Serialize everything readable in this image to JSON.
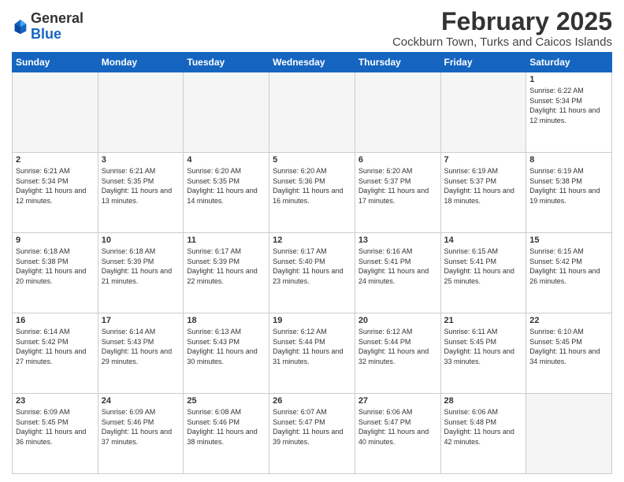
{
  "header": {
    "logo_general": "General",
    "logo_blue": "Blue",
    "month_title": "February 2025",
    "subtitle": "Cockburn Town, Turks and Caicos Islands"
  },
  "weekdays": [
    "Sunday",
    "Monday",
    "Tuesday",
    "Wednesday",
    "Thursday",
    "Friday",
    "Saturday"
  ],
  "weeks": [
    [
      {
        "day": "",
        "info": ""
      },
      {
        "day": "",
        "info": ""
      },
      {
        "day": "",
        "info": ""
      },
      {
        "day": "",
        "info": ""
      },
      {
        "day": "",
        "info": ""
      },
      {
        "day": "",
        "info": ""
      },
      {
        "day": "1",
        "info": "Sunrise: 6:22 AM\nSunset: 5:34 PM\nDaylight: 11 hours and 12 minutes."
      }
    ],
    [
      {
        "day": "2",
        "info": "Sunrise: 6:21 AM\nSunset: 5:34 PM\nDaylight: 11 hours and 12 minutes."
      },
      {
        "day": "3",
        "info": "Sunrise: 6:21 AM\nSunset: 5:35 PM\nDaylight: 11 hours and 13 minutes."
      },
      {
        "day": "4",
        "info": "Sunrise: 6:20 AM\nSunset: 5:35 PM\nDaylight: 11 hours and 14 minutes."
      },
      {
        "day": "5",
        "info": "Sunrise: 6:20 AM\nSunset: 5:36 PM\nDaylight: 11 hours and 16 minutes."
      },
      {
        "day": "6",
        "info": "Sunrise: 6:20 AM\nSunset: 5:37 PM\nDaylight: 11 hours and 17 minutes."
      },
      {
        "day": "7",
        "info": "Sunrise: 6:19 AM\nSunset: 5:37 PM\nDaylight: 11 hours and 18 minutes."
      },
      {
        "day": "8",
        "info": "Sunrise: 6:19 AM\nSunset: 5:38 PM\nDaylight: 11 hours and 19 minutes."
      }
    ],
    [
      {
        "day": "9",
        "info": "Sunrise: 6:18 AM\nSunset: 5:38 PM\nDaylight: 11 hours and 20 minutes."
      },
      {
        "day": "10",
        "info": "Sunrise: 6:18 AM\nSunset: 5:39 PM\nDaylight: 11 hours and 21 minutes."
      },
      {
        "day": "11",
        "info": "Sunrise: 6:17 AM\nSunset: 5:39 PM\nDaylight: 11 hours and 22 minutes."
      },
      {
        "day": "12",
        "info": "Sunrise: 6:17 AM\nSunset: 5:40 PM\nDaylight: 11 hours and 23 minutes."
      },
      {
        "day": "13",
        "info": "Sunrise: 6:16 AM\nSunset: 5:41 PM\nDaylight: 11 hours and 24 minutes."
      },
      {
        "day": "14",
        "info": "Sunrise: 6:15 AM\nSunset: 5:41 PM\nDaylight: 11 hours and 25 minutes."
      },
      {
        "day": "15",
        "info": "Sunrise: 6:15 AM\nSunset: 5:42 PM\nDaylight: 11 hours and 26 minutes."
      }
    ],
    [
      {
        "day": "16",
        "info": "Sunrise: 6:14 AM\nSunset: 5:42 PM\nDaylight: 11 hours and 27 minutes."
      },
      {
        "day": "17",
        "info": "Sunrise: 6:14 AM\nSunset: 5:43 PM\nDaylight: 11 hours and 29 minutes."
      },
      {
        "day": "18",
        "info": "Sunrise: 6:13 AM\nSunset: 5:43 PM\nDaylight: 11 hours and 30 minutes."
      },
      {
        "day": "19",
        "info": "Sunrise: 6:12 AM\nSunset: 5:44 PM\nDaylight: 11 hours and 31 minutes."
      },
      {
        "day": "20",
        "info": "Sunrise: 6:12 AM\nSunset: 5:44 PM\nDaylight: 11 hours and 32 minutes."
      },
      {
        "day": "21",
        "info": "Sunrise: 6:11 AM\nSunset: 5:45 PM\nDaylight: 11 hours and 33 minutes."
      },
      {
        "day": "22",
        "info": "Sunrise: 6:10 AM\nSunset: 5:45 PM\nDaylight: 11 hours and 34 minutes."
      }
    ],
    [
      {
        "day": "23",
        "info": "Sunrise: 6:09 AM\nSunset: 5:45 PM\nDaylight: 11 hours and 36 minutes."
      },
      {
        "day": "24",
        "info": "Sunrise: 6:09 AM\nSunset: 5:46 PM\nDaylight: 11 hours and 37 minutes."
      },
      {
        "day": "25",
        "info": "Sunrise: 6:08 AM\nSunset: 5:46 PM\nDaylight: 11 hours and 38 minutes."
      },
      {
        "day": "26",
        "info": "Sunrise: 6:07 AM\nSunset: 5:47 PM\nDaylight: 11 hours and 39 minutes."
      },
      {
        "day": "27",
        "info": "Sunrise: 6:06 AM\nSunset: 5:47 PM\nDaylight: 11 hours and 40 minutes."
      },
      {
        "day": "28",
        "info": "Sunrise: 6:06 AM\nSunset: 5:48 PM\nDaylight: 11 hours and 42 minutes."
      },
      {
        "day": "",
        "info": ""
      }
    ]
  ]
}
